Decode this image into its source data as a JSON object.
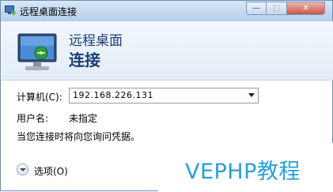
{
  "window": {
    "title": "远程桌面连接"
  },
  "title_controls": {
    "minimize": "—",
    "maximize": "□",
    "close": "✕"
  },
  "banner": {
    "line1": "远程桌面",
    "line2": "连接"
  },
  "form": {
    "computer_label": "计算机(C):",
    "computer_value": "192.168.226.131",
    "user_label": "用户名:",
    "user_value": "未指定",
    "note": "当您连接时将向您询问凭据。"
  },
  "options": {
    "label": "选项(O)"
  },
  "watermark": {
    "text": "VEPHP教程"
  },
  "colors": {
    "accent": "#1b3d75",
    "watermark": "#2a9fd6"
  },
  "icons": [
    "app-icon",
    "monitor-icon",
    "chevron-down-icon"
  ]
}
